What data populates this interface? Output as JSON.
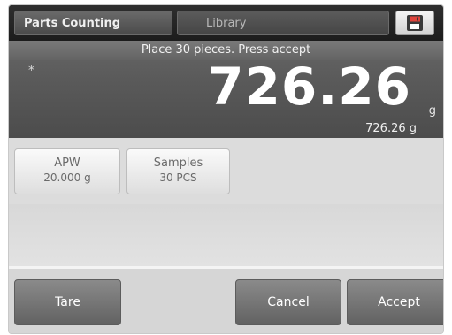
{
  "header": {
    "app_label": "Parts Counting",
    "library_label": "Library",
    "save_icon": "save-icon"
  },
  "display": {
    "prompt": "Place 30 pieces.  Press accept",
    "stable_indicator": "*",
    "weight_value": "726.26",
    "unit": "g",
    "secondary_readout": "726.26 g"
  },
  "tiles": {
    "apw": {
      "label": "APW",
      "value": "20.000 g"
    },
    "samples": {
      "label": "Samples",
      "value": "30 PCS"
    }
  },
  "buttons": {
    "tare": "Tare",
    "cancel": "Cancel",
    "accept": "Accept"
  },
  "colors": {
    "display_bg": "#5a5a5a",
    "topbar_bg": "#1c1c1c",
    "button_bg": "#6f6f6f",
    "tile_bg": "#eeeeee",
    "save_icon_accent": "#e0443c"
  }
}
